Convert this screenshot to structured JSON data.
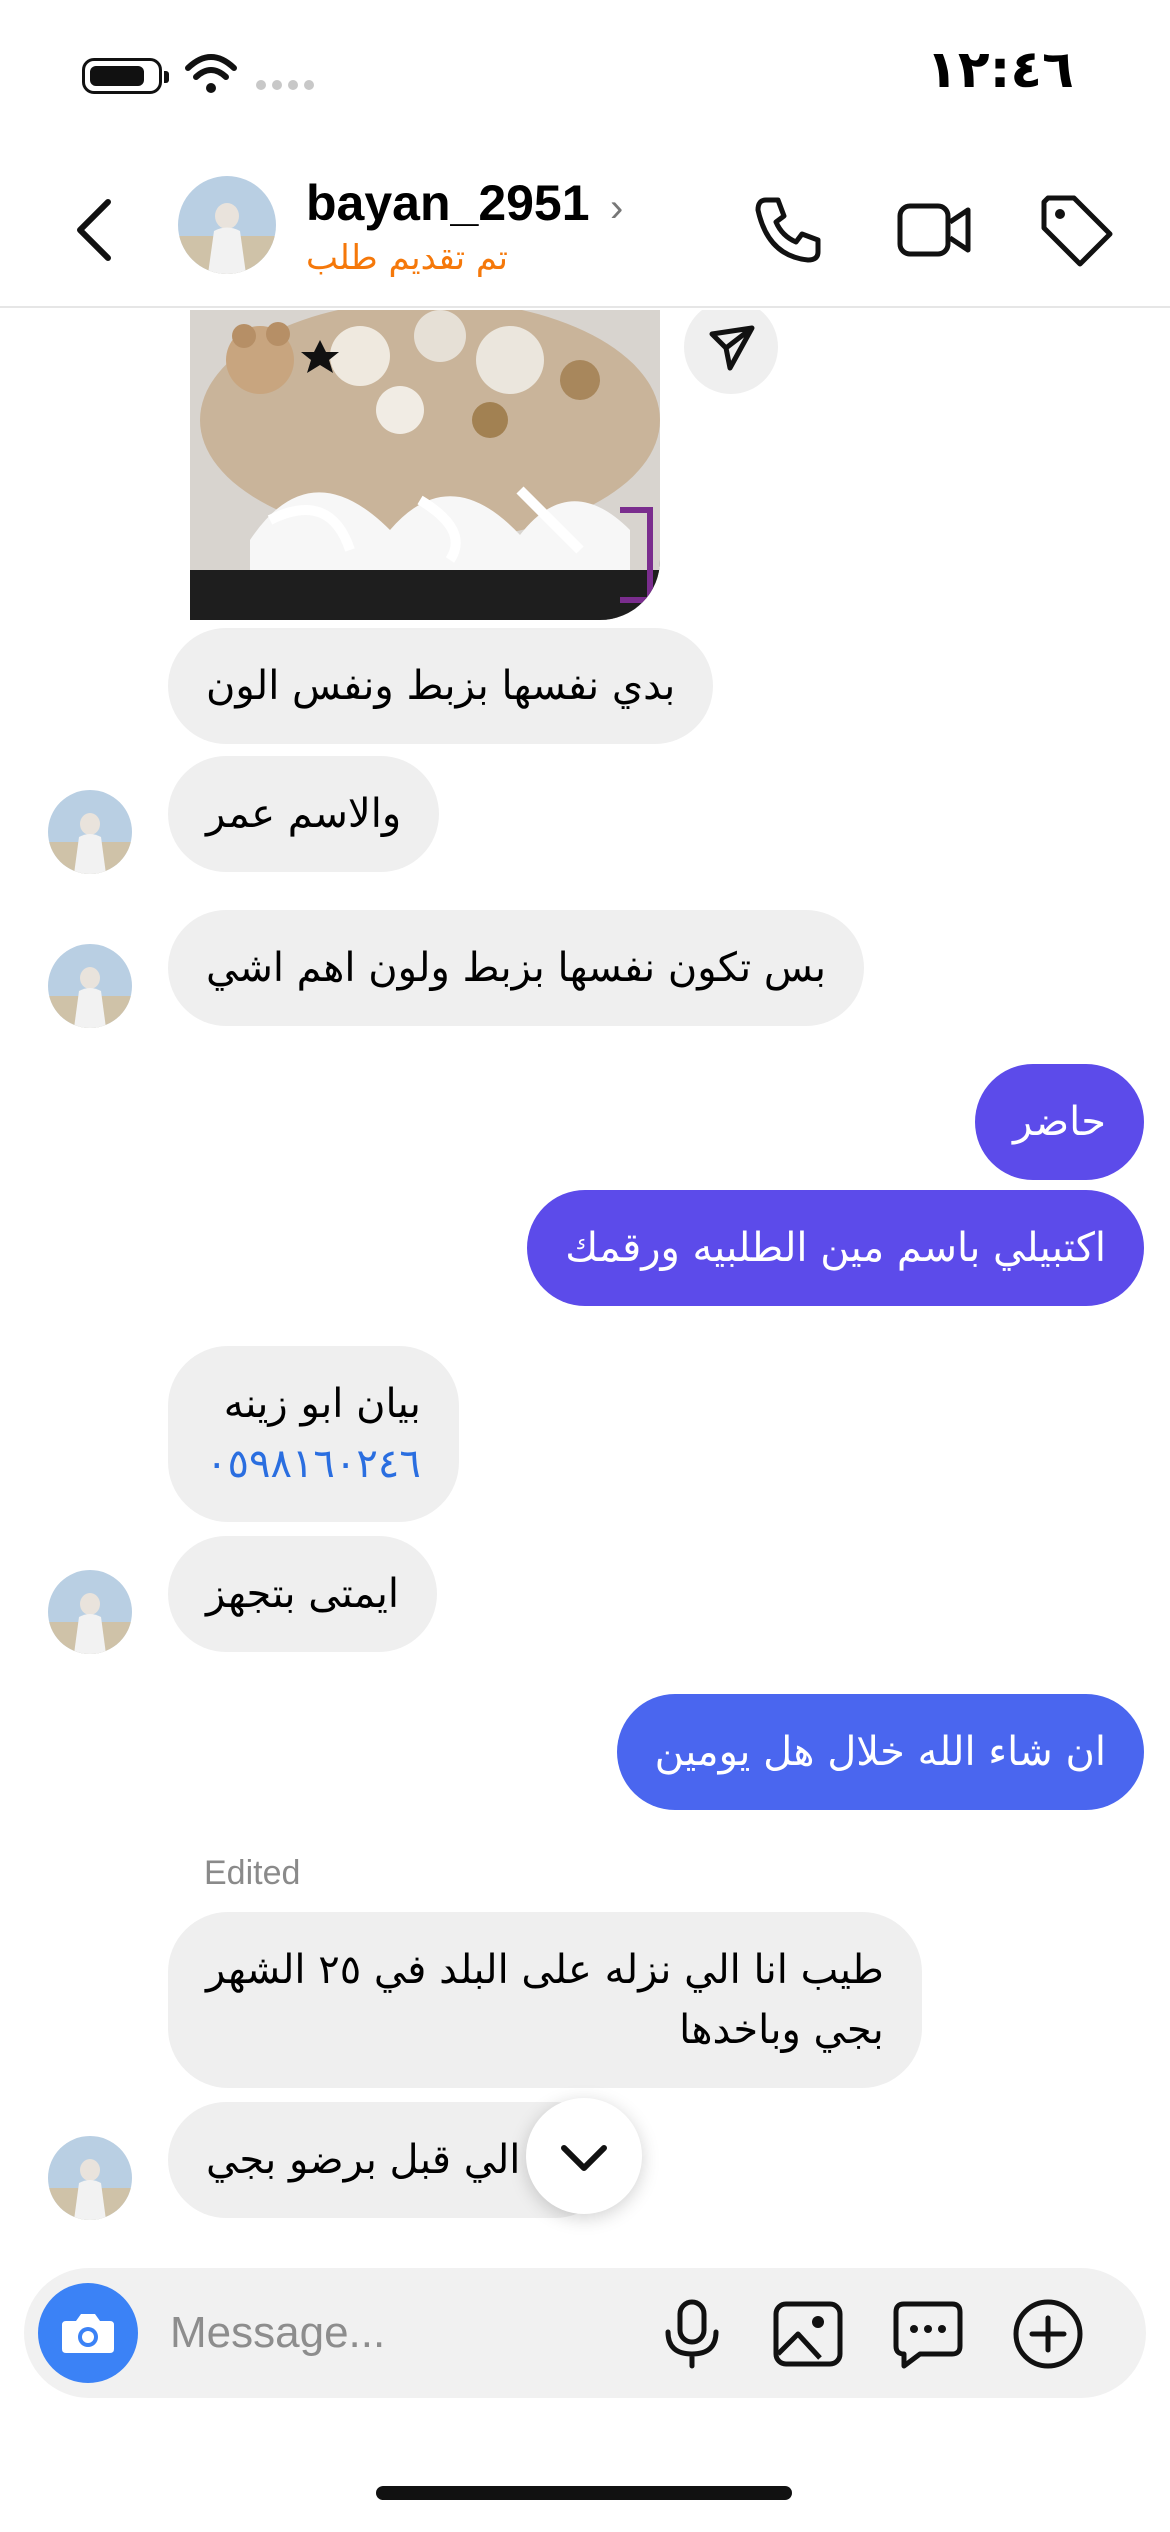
{
  "status_bar": {
    "time": "١٢:٤٦"
  },
  "header": {
    "username": "bayan_2951",
    "subtitle": "تم تقديم طلب"
  },
  "messages": [
    {
      "id": "m1",
      "side": "in",
      "text": "بدي نفسها بزبط ونفس الون"
    },
    {
      "id": "m2",
      "side": "in",
      "text": "والاسم عمر"
    },
    {
      "id": "m3",
      "side": "in",
      "text": "بس تكون نفسها بزبط ولون اهم اشي"
    },
    {
      "id": "m4",
      "side": "out",
      "text": "حاضر"
    },
    {
      "id": "m5",
      "side": "out",
      "text": "اكتبيلي باسم مين الطلبيه ورقمك"
    },
    {
      "id": "m6",
      "side": "in",
      "text": "بيان ابو زينه",
      "link": "٠٥٩٨١٦٠٢٤٦"
    },
    {
      "id": "m7",
      "side": "in",
      "text": "ايمتى بتجهز"
    },
    {
      "id": "m8",
      "side": "out",
      "text": "ان شاء الله خلال هل يومين"
    },
    {
      "id": "m9",
      "side": "in",
      "edited_label": "Edited",
      "line1": "طيب انا الي نزله على البلد في  ٢٥ الشهر",
      "line2": "بجي وباخدها"
    },
    {
      "id": "m10",
      "side": "in",
      "text": "اوا الي قبل برضو بجي"
    }
  ],
  "composer": {
    "placeholder": "Message..."
  },
  "colors": {
    "incoming_bubble": "#efefef",
    "outgoing_purple": "#5c4bea",
    "outgoing_blue": "#4a66ef",
    "subtitle_orange": "#f5780a",
    "link_blue": "#2a6ee0"
  },
  "icons": [
    "battery-icon",
    "wifi-icon",
    "back-icon",
    "chevron-right-icon",
    "phone-icon",
    "video-icon",
    "tag-icon",
    "send-icon",
    "chevron-down-icon",
    "camera-icon",
    "mic-icon",
    "gallery-icon",
    "sticker-icon",
    "plus-icon"
  ]
}
